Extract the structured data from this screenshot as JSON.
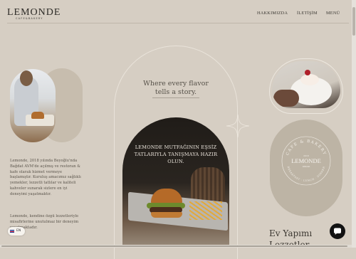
{
  "brand": {
    "name": "LEMONDE",
    "tagline": "CAFE&BAKERY"
  },
  "nav": {
    "items": [
      "HAKKIMIZDA",
      "İLETİŞİM",
      "MENÜ"
    ]
  },
  "hero": {
    "tagline": "Where every flavor tells a story."
  },
  "about": {
    "paragraph1": "Lemonde, 2018 yılında Beyoğlu'nda Bağdat AVM'de açılmış ve restoran & kafe olarak hizmet vermeye başlamıştır. Kuruluş amacımız sağlıklı yemekler, lezzetli tatlılar ve kaliteli kahveler sunarak sizlere en iyi deneyimi yaşatmaktır.",
    "paragraph2": "Lemonde, kendine özgü lezzetleriyle misafirlerine unutulmaz bir deneyim yaşatmaktadır."
  },
  "feature": {
    "text": "LEMONDE MUTFAĞININ EŞSİZ TATLARIYLA TANIŞMAYA HAZIR OLUN."
  },
  "badge": {
    "name": "LEMONDE",
    "top": "CAFE & BAKERY",
    "bottom": "BREAKFAST · LUNCH · DINNER",
    "since": "2018",
    "sub": "ANKARA"
  },
  "section": {
    "title": "Ev Yapımı",
    "title_cont": "Lezzetler"
  },
  "language": {
    "code": "EN",
    "flag_icon": "uk-flag-icon"
  },
  "chat": {
    "icon": "chat-icon"
  },
  "colors": {
    "background": "#d6cec3",
    "dark": "#201c18",
    "accent": "#ede7de"
  }
}
